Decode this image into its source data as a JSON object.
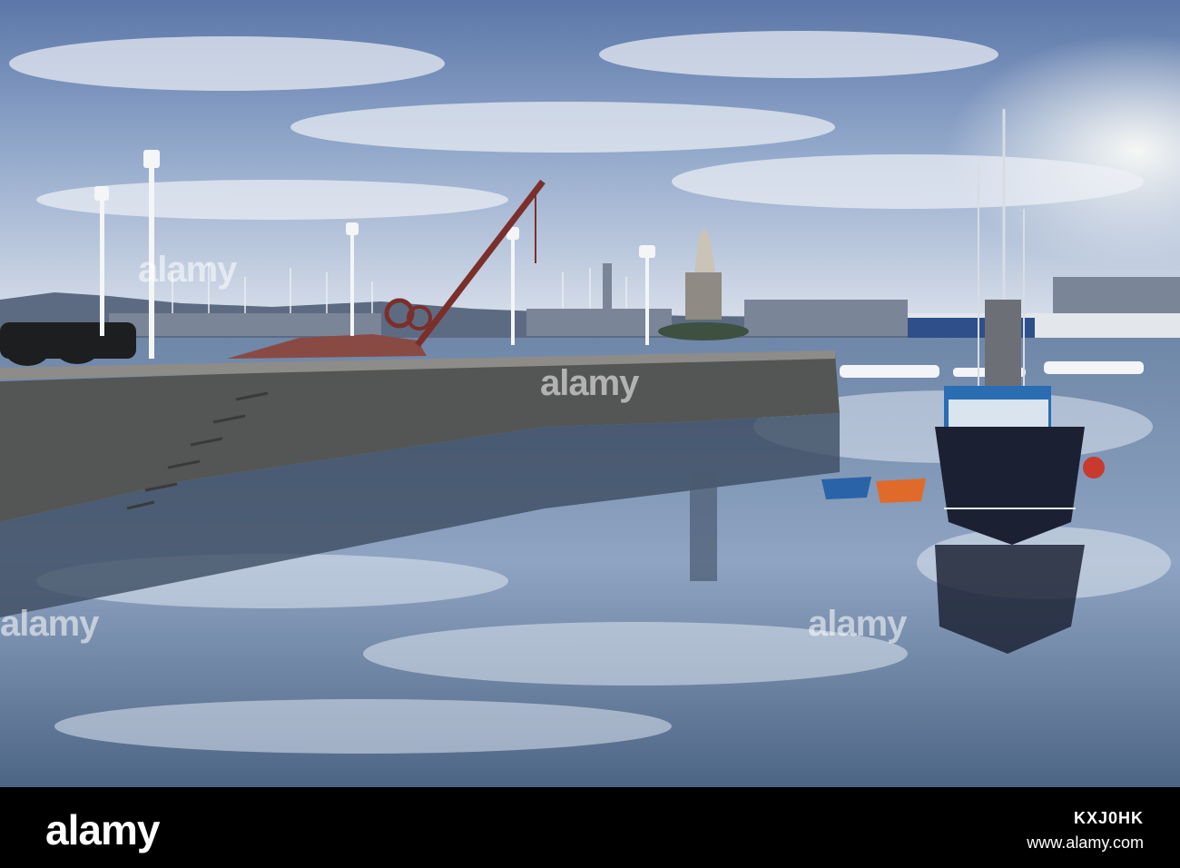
{
  "watermarks": [
    "alamy",
    "alamy",
    "alamy",
    "alamy"
  ],
  "footer": {
    "logo": "alamy",
    "image_id": "KXJ0HK",
    "site": "www.alamy.com"
  }
}
